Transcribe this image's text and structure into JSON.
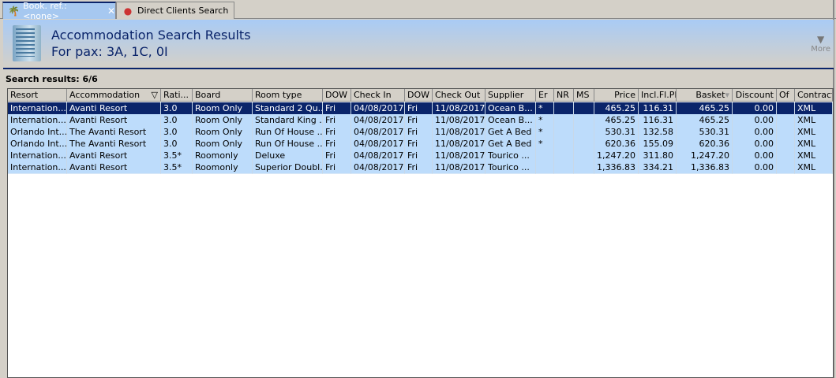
{
  "tabs": [
    {
      "label": "Book. ref.: <none>",
      "icon": "palm-tree-icon",
      "active": true
    },
    {
      "label": "Direct Clients Search",
      "icon": "person-icon",
      "active": false
    }
  ],
  "header": {
    "title": "Accommodation Search Results",
    "subtitle": "For pax: 3A, 1C, 0I",
    "more_label": "More",
    "icon": "hotel-building-icon"
  },
  "results_count": "Search results: 6/6",
  "columns": [
    "Resort",
    "Accommodation",
    "Rati...",
    "Board",
    "Room type",
    "DOW",
    "Check In",
    "DOW",
    "Check Out",
    "Supplier",
    "Er",
    "NR",
    "MS",
    "Price",
    "Incl.Fl.PP",
    "Basket",
    "Discount",
    "Of",
    "Contract"
  ],
  "rows": [
    [
      "Internation...",
      "Avanti Resort",
      "3.0",
      "Room Only",
      "Standard 2 Qu...",
      "Fri",
      "04/08/2017",
      "Fri",
      "11/08/2017",
      "Ocean B...",
      "*",
      "",
      "",
      "465.25",
      "116.31",
      "465.25",
      "0.00",
      "",
      "XML"
    ],
    [
      "Internation...",
      "Avanti Resort",
      "3.0",
      "Room Only",
      "Standard King ...",
      "Fri",
      "04/08/2017",
      "Fri",
      "11/08/2017",
      "Ocean B...",
      "*",
      "",
      "",
      "465.25",
      "116.31",
      "465.25",
      "0.00",
      "",
      "XML"
    ],
    [
      "Orlando Int...",
      "The Avanti Resort",
      "3.0",
      "Room Only",
      "Run Of House ...",
      "Fri",
      "04/08/2017",
      "Fri",
      "11/08/2017",
      "Get A Bed",
      "*",
      "",
      "",
      "530.31",
      "132.58",
      "530.31",
      "0.00",
      "",
      "XML"
    ],
    [
      "Orlando Int...",
      "The Avanti Resort",
      "3.0",
      "Room Only",
      "Run Of House ...",
      "Fri",
      "04/08/2017",
      "Fri",
      "11/08/2017",
      "Get A Bed",
      "*",
      "",
      "",
      "620.36",
      "155.09",
      "620.36",
      "0.00",
      "",
      "XML"
    ],
    [
      "Internation...",
      "Avanti Resort",
      "3.5*",
      "Roomonly",
      "Deluxe",
      "Fri",
      "04/08/2017",
      "Fri",
      "11/08/2017",
      "Tourico ...",
      "",
      "",
      "",
      "1,247.20",
      "311.80",
      "1,247.20",
      "0.00",
      "",
      "XML"
    ],
    [
      "Internation...",
      "Avanti Resort",
      "3.5*",
      "Roomonly",
      "Superior Doubl...",
      "Fri",
      "04/08/2017",
      "Fri",
      "11/08/2017",
      "Tourico ...",
      "",
      "",
      "",
      "1,336.83",
      "334.21",
      "1,336.83",
      "0.00",
      "",
      "XML"
    ]
  ],
  "selected_row": 0,
  "colors": {
    "selection": "#0a246a",
    "row": "#bddcfb",
    "header_gradient_top": "#a9cbf5"
  }
}
